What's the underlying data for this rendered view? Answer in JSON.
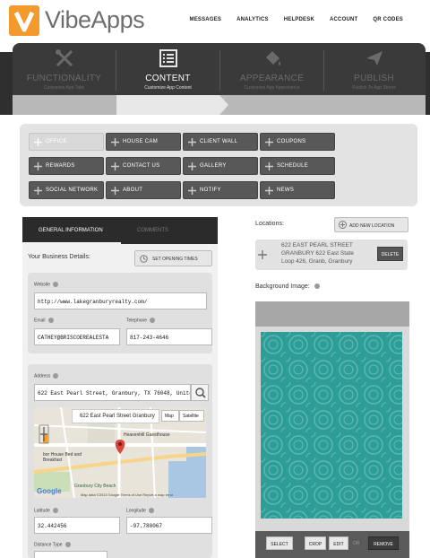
{
  "brand": {
    "name": "VibeApps"
  },
  "top_nav": [
    "MESSAGES",
    "ANALYTICS",
    "HELPDESK",
    "ACCOUNT",
    "QR CODES"
  ],
  "tabs": [
    {
      "label": "FUNCTIONALITY",
      "sub": "Customize App Tabs",
      "icon": "wrench-screwdriver-icon",
      "active": false
    },
    {
      "label": "CONTENT",
      "sub": "Customize App Content",
      "icon": "list-icon",
      "active": true
    },
    {
      "label": "APPEARANCE",
      "sub": "Customize App Appearance",
      "icon": "paint-bucket-icon",
      "active": false
    },
    {
      "label": "PUBLISH",
      "sub": "Publish To App Stores",
      "icon": "paper-plane-icon",
      "active": false
    }
  ],
  "menu": [
    {
      "label": "OFFICE",
      "active": true
    },
    {
      "label": "HOUSE CAM",
      "active": false
    },
    {
      "label": "CLIENT WALL",
      "active": false
    },
    {
      "label": "COUPONS",
      "active": false
    },
    {
      "label": "REWARDS",
      "active": false
    },
    {
      "label": "CONTACT US",
      "active": false
    },
    {
      "label": "GALLERY",
      "active": false
    },
    {
      "label": "SCHEDULE",
      "active": false
    },
    {
      "label": "SOCIAL NETWORK",
      "active": false
    },
    {
      "label": "ABOUT",
      "active": false
    },
    {
      "label": "NOTIFY",
      "active": false
    },
    {
      "label": "NEWS",
      "active": false
    }
  ],
  "left": {
    "tab_general": "GENERAL INFORMATION",
    "tab_comments": "COMMENTS",
    "details_label": "Your Business Details:",
    "opening_times": "SET OPENING TIMES",
    "website_label": "Website",
    "website_value": "http://www.lakegranburyrealty.com/",
    "email_label": "Email",
    "email_value": "CATHEY@BRISCOEREALESTA",
    "telephone_label": "Telephone",
    "telephone_value": "817-243-4646",
    "address_label": "Address",
    "address_value": "622 East Pearl Street, Granbury, TX 76048, United St",
    "map": {
      "tip": "622 East Pearl Street Granbury",
      "map_btn": "Map",
      "sat_btn": "Satellite",
      "label1": "Heavenhill Guesthouse",
      "label2": "bor House Bed and Breakfast",
      "label3": "Granbury City Beach",
      "footer": "Map data ©2013 Google     Terms of Use     Report a map error",
      "google": "Google"
    },
    "latitude_label": "Latitude",
    "latitude_value": "32.442456",
    "longitude_label": "Longitude",
    "longitude_value": "-97.780067",
    "distance_label": "Distance Type"
  },
  "right": {
    "locations_label": "Locations:",
    "add_location": "ADD NEW LOCATION",
    "location_line1": "622 EAST PEARL STREET",
    "location_line2": "GRANBURY 622 East State",
    "location_line3": "Loop 426, Granb, Granbury",
    "delete_btn": "DELETE",
    "bg_label": "Background Image:",
    "select_btn": "SELECT",
    "crop_btn": "CROP",
    "edit_btn": "EDIT",
    "or_label": "OR",
    "remove_btn": "REMOVE"
  },
  "colors": {
    "accent": "#f29a2e",
    "dark": "#2f2f2f",
    "teal": "#2e9c97",
    "menu_btn": "#585858"
  }
}
